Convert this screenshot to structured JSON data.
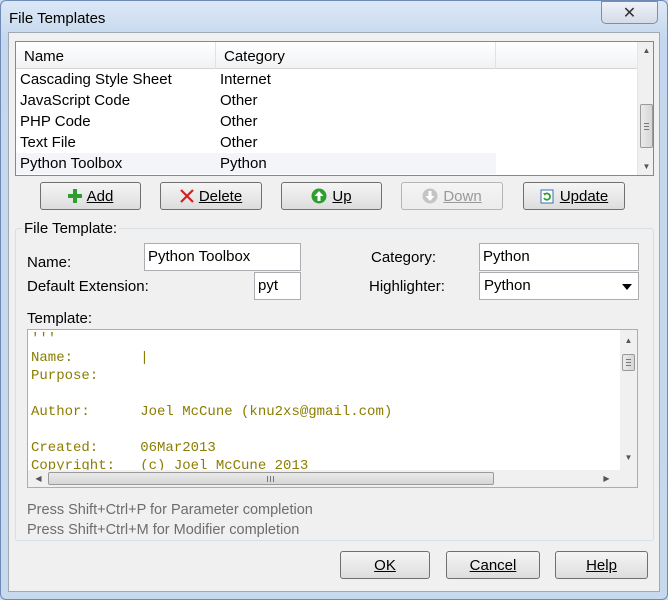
{
  "window": {
    "title": "File Templates",
    "close_glyph": "✕"
  },
  "grid": {
    "columns": [
      "Name",
      "Category"
    ],
    "rows": [
      {
        "name": "Cascading Style Sheet",
        "category": "Internet"
      },
      {
        "name": "JavaScript Code",
        "category": "Other"
      },
      {
        "name": "PHP Code",
        "category": "Other"
      },
      {
        "name": "Text File",
        "category": "Other"
      },
      {
        "name": "Python Toolbox",
        "category": "Python"
      }
    ],
    "selected_index": 4
  },
  "toolbar": {
    "add_label": "Add",
    "delete_label": "Delete",
    "up_label": "Up",
    "down_label": "Down",
    "update_label": "Update"
  },
  "form": {
    "group_label": "File Template:",
    "name_label": "Name:",
    "name_value": "Python Toolbox",
    "extension_label": "Default Extension:",
    "extension_value": "pyt",
    "category_label": "Category:",
    "category_value": "Python",
    "highlighter_label": "Highlighter:",
    "highlighter_value": "Python",
    "template_label": "Template:"
  },
  "editor": {
    "lines": [
      "'''",
      "Name:        |",
      "Purpose:",
      "",
      "Author:      Joel McCune (knu2xs@gmail.com)",
      "",
      "Created:     06Mar2013",
      "Copyright:   (c) Joel McCune 2013"
    ]
  },
  "hints": {
    "parameter": "Press Shift+Ctrl+P for Parameter completion",
    "modifier": "Press Shift+Ctrl+M for Modifier completion"
  },
  "footer": {
    "ok_label": "OK",
    "cancel_label": "Cancel",
    "help_label": "Help"
  },
  "colors": {
    "code_text": "#8b7d00",
    "add_icon": "#2e9e2e",
    "delete_icon": "#d62020",
    "up_icon": "#2e9e2e",
    "window_frame": "#c9d9ee"
  }
}
